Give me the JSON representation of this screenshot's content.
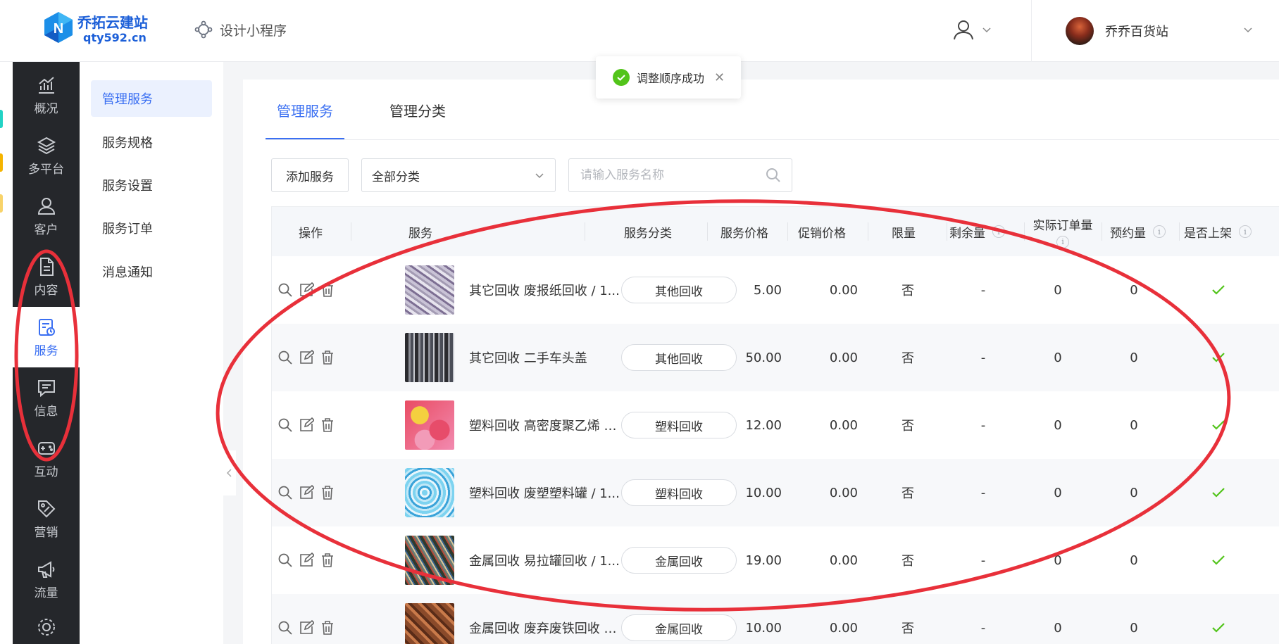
{
  "brand": {
    "name": "乔拓云建站",
    "domain": "qty592.cn"
  },
  "header": {
    "design_label": "设计小程序",
    "store_name": "乔乔百货站"
  },
  "nav": [
    {
      "label": "概况",
      "icon": "chart-icon"
    },
    {
      "label": "多平台",
      "icon": "layers-icon"
    },
    {
      "label": "客户",
      "icon": "user-icon"
    },
    {
      "label": "内容",
      "icon": "document-icon"
    },
    {
      "label": "服务",
      "icon": "service-icon",
      "active": true
    },
    {
      "label": "信息",
      "icon": "message-icon"
    },
    {
      "label": "互动",
      "icon": "game-icon"
    },
    {
      "label": "营销",
      "icon": "tag-icon"
    },
    {
      "label": "流量",
      "icon": "megaphone-icon"
    }
  ],
  "submenu": [
    {
      "label": "管理服务",
      "active": true
    },
    {
      "label": "服务规格"
    },
    {
      "label": "服务设置"
    },
    {
      "label": "服务订单"
    },
    {
      "label": "消息通知"
    }
  ],
  "tabs": [
    "管理服务",
    "管理分类"
  ],
  "toolbar": {
    "add_label": "添加服务",
    "category_value": "全部分类",
    "search_placeholder": "请输入服务名称"
  },
  "toast": {
    "text": "调整顺序成功"
  },
  "table": {
    "columns": {
      "ops": "操作",
      "service": "服务",
      "category": "服务分类",
      "price": "服务价格",
      "promo": "促销价格",
      "limit": "限量",
      "remaining": "剩余量",
      "actual_orders": "实际订单量",
      "reserved": "预约量",
      "on_shelf": "是否上架"
    },
    "info_glyph": "i",
    "rows": [
      {
        "name": "其它回收 废报纸回收 / 1...",
        "category": "其他回收",
        "price": "5.00",
        "promo": "0.00",
        "limit": "否",
        "remaining": "-",
        "orders": "0",
        "reserved": "0"
      },
      {
        "name": "其它回收 二手车头盖",
        "category": "其他回收",
        "price": "50.00",
        "promo": "0.00",
        "limit": "否",
        "remaining": "-",
        "orders": "0",
        "reserved": "0"
      },
      {
        "name": "塑料回收 高密度聚乙烯 /...",
        "category": "塑料回收",
        "price": "12.00",
        "promo": "0.00",
        "limit": "否",
        "remaining": "-",
        "orders": "0",
        "reserved": "0"
      },
      {
        "name": "塑料回收 废塑塑料罐 / 1...",
        "category": "塑料回收",
        "price": "10.00",
        "promo": "0.00",
        "limit": "否",
        "remaining": "-",
        "orders": "0",
        "reserved": "0"
      },
      {
        "name": "金属回收 易拉罐回收 / 1...",
        "category": "金属回收",
        "price": "19.00",
        "promo": "0.00",
        "limit": "否",
        "remaining": "-",
        "orders": "0",
        "reserved": "0"
      },
      {
        "name": "金属回收 废弃废铁回收 /...",
        "category": "金属回收",
        "price": "10.00",
        "promo": "0.00",
        "limit": "否",
        "remaining": "-",
        "orders": "0",
        "reserved": "0"
      }
    ]
  },
  "colors": {
    "primary": "#3a6ff2",
    "dark_nav": "#25272b",
    "success": "#52c41a",
    "annotation": "#e8303a"
  }
}
